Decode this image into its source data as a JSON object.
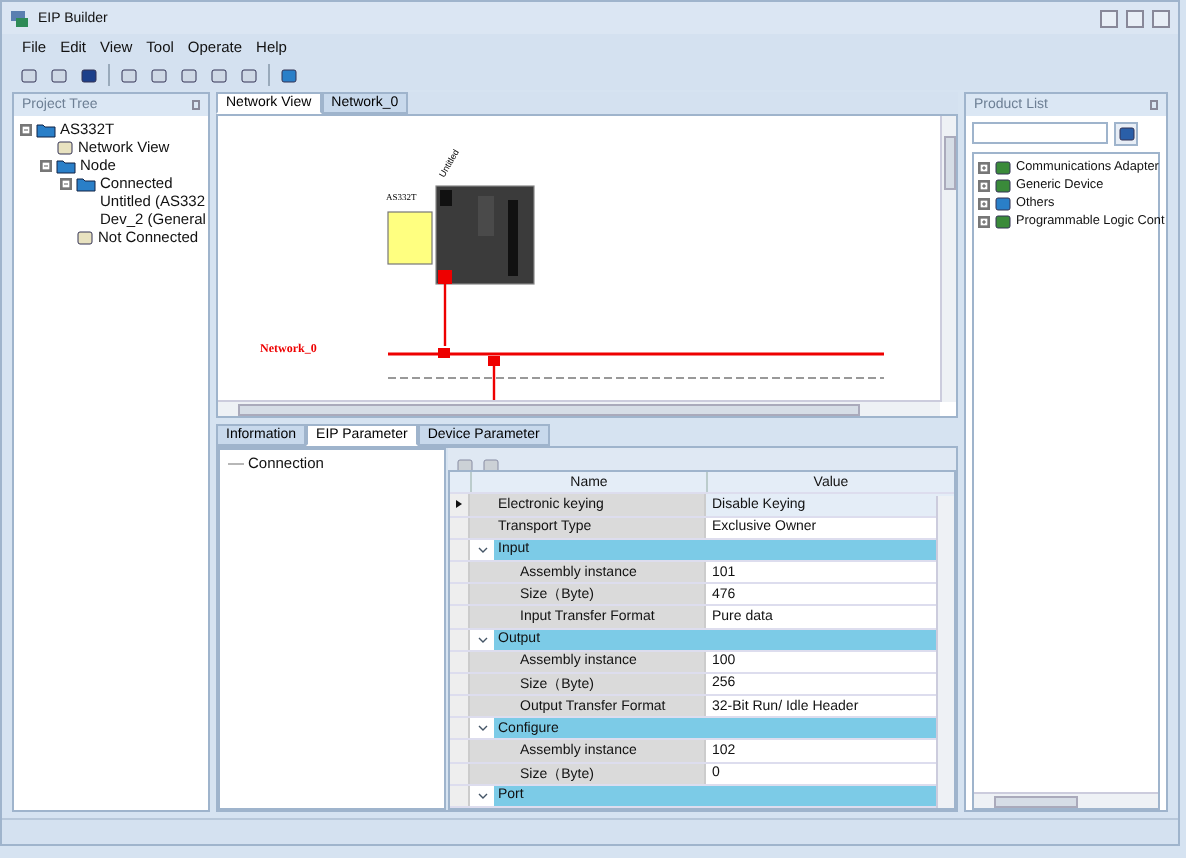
{
  "window": {
    "title": "EIP Builder"
  },
  "menu": [
    "File",
    "Edit",
    "View",
    "Tool",
    "Operate",
    "Help"
  ],
  "project_tree": {
    "title": "Project Tree",
    "items": [
      {
        "label": "AS332T",
        "expanded": true,
        "children": [
          {
            "label": "Network View"
          },
          {
            "label": "Node",
            "expanded": true,
            "children": [
              {
                "label": "Connected",
                "expanded": true,
                "children": [
                  {
                    "label": "Untitled (AS332"
                  },
                  {
                    "label": "Dev_2 (General"
                  }
                ]
              },
              {
                "label": "Not Connected"
              }
            ]
          }
        ]
      }
    ]
  },
  "document_tabs": [
    {
      "label": "Network View",
      "selected": true
    },
    {
      "label": "Network_0",
      "selected": false
    }
  ],
  "network": {
    "network_name": "Network_0",
    "device_name": "Untitled",
    "device_model": "AS332T"
  },
  "bottom_tabs": [
    {
      "label": "Information",
      "selected": false
    },
    {
      "label": "EIP Parameter",
      "selected": true
    },
    {
      "label": "Device Parameter",
      "selected": false
    }
  ],
  "connection_tree": [
    "Connection"
  ],
  "parameter_grid": {
    "columns": [
      "Name",
      "Value"
    ],
    "rows": [
      {
        "kind": "param",
        "name": "Electronic keying",
        "value": "Disable Keying",
        "selected": true
      },
      {
        "kind": "param",
        "name": "Transport Type",
        "value": "Exclusive Owner",
        "selected": false
      },
      {
        "kind": "group",
        "name": "Input",
        "expanded": true,
        "selected": false
      },
      {
        "kind": "param",
        "name": "Assembly instance",
        "value": "101",
        "selected": false
      },
      {
        "kind": "param",
        "name": "Size（Byte)",
        "value": "476",
        "selected": false
      },
      {
        "kind": "param",
        "name": "Input Transfer Format",
        "value": "Pure data",
        "selected": false
      },
      {
        "kind": "group",
        "name": "Output",
        "expanded": true,
        "selected": false
      },
      {
        "kind": "param",
        "name": "Assembly instance",
        "value": "100",
        "selected": false
      },
      {
        "kind": "param",
        "name": "Size（Byte)",
        "value": "256",
        "selected": false
      },
      {
        "kind": "param",
        "name": "Output Transfer Format",
        "value": "32-Bit Run/ Idle Header",
        "selected": false
      },
      {
        "kind": "group",
        "name": "Configure",
        "expanded": true,
        "selected": false
      },
      {
        "kind": "param",
        "name": "Assembly instance",
        "value": "102",
        "selected": false
      },
      {
        "kind": "param",
        "name": "Size（Byte)",
        "value": "0",
        "selected": false
      },
      {
        "kind": "group",
        "name": "Port",
        "expanded": true,
        "selected": false
      }
    ]
  },
  "product_list": {
    "title": "Product List",
    "items": [
      {
        "label": "Communications Adapter",
        "expanded": false
      },
      {
        "label": "Generic Device",
        "expanded": false
      },
      {
        "label": "Others",
        "expanded": false
      },
      {
        "label": "Programmable Logic Cont",
        "expanded": false
      }
    ]
  }
}
